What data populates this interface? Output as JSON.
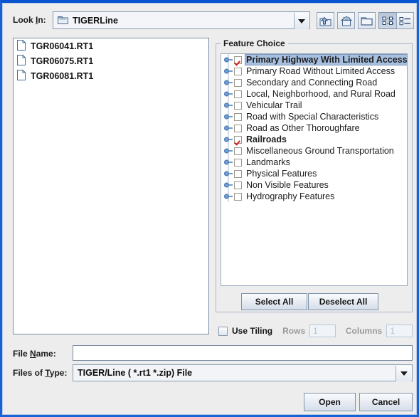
{
  "toolbar": {
    "look_in_label": "Look In:",
    "look_in_label_pre": "Look ",
    "look_in_label_underlined": "I",
    "look_in_label_post": "n:",
    "look_in_value": "TIGERLine",
    "look_in_icon": "folder-icon",
    "dropdown_icon": "chevron-down-icon",
    "buttons": [
      {
        "name": "up-one-level-button",
        "icon": "folder-up-icon",
        "pressed": false
      },
      {
        "name": "home-button",
        "icon": "home-icon",
        "pressed": false
      },
      {
        "name": "new-folder-button",
        "icon": "new-folder-icon",
        "pressed": false
      },
      {
        "name": "tiles-view-button",
        "icon": "grid-view-icon",
        "pressed": true
      },
      {
        "name": "details-view-button",
        "icon": "list-view-icon",
        "pressed": false
      }
    ]
  },
  "file_list": {
    "items": [
      {
        "label": "TGR06041.RT1",
        "icon": "file-icon"
      },
      {
        "label": "TGR06075.RT1",
        "icon": "file-icon"
      },
      {
        "label": "TGR06081.RT1",
        "icon": "file-icon"
      }
    ]
  },
  "feature_choice": {
    "legend": "Feature Choice",
    "tree_items": [
      {
        "label": "Primary Highway With Limited Access",
        "checked": true,
        "selected": true
      },
      {
        "label": "Primary Road Without Limited Access",
        "checked": false,
        "selected": false
      },
      {
        "label": "Secondary and Connecting Road",
        "checked": false,
        "selected": false
      },
      {
        "label": "Local, Neighborhood, and Rural Road",
        "checked": false,
        "selected": false
      },
      {
        "label": "Vehicular Trail",
        "checked": false,
        "selected": false
      },
      {
        "label": "Road with Special Characteristics",
        "checked": false,
        "selected": false
      },
      {
        "label": "Road as Other Thoroughfare",
        "checked": false,
        "selected": false
      },
      {
        "label": "Railroads",
        "checked": true,
        "selected": false
      },
      {
        "label": "Miscellaneous Ground Transportation",
        "checked": false,
        "selected": false
      },
      {
        "label": "Landmarks",
        "checked": false,
        "selected": false
      },
      {
        "label": "Physical Features",
        "checked": false,
        "selected": false
      },
      {
        "label": "Non Visible Features",
        "checked": false,
        "selected": false
      },
      {
        "label": "Hydrography Features",
        "checked": false,
        "selected": false
      }
    ],
    "select_all_label": "Select All",
    "deselect_all_label": "Deselect All"
  },
  "tiling": {
    "checkbox_label": "Use Tiling",
    "checked": false,
    "rows_label": "Rows",
    "rows_value": "1",
    "columns_label": "Columns",
    "columns_value": "1",
    "enabled": false
  },
  "file_name": {
    "label_pre": "File ",
    "label_underlined": "N",
    "label_post": "ame:",
    "value": "",
    "placeholder": ""
  },
  "files_of_type": {
    "label_pre": "Files of ",
    "label_underlined": "T",
    "label_post": "ype:",
    "value": "TIGER/Line ( *.rt1 *.zip) File",
    "dropdown_icon": "chevron-down-icon"
  },
  "dialog_buttons": {
    "open_label": "Open",
    "cancel_label": "Cancel"
  },
  "colors": {
    "window_border": "#1763d6",
    "background": "#ededed",
    "selection": "#a8c0e0",
    "check_mark": "#d41d1d",
    "text": "#1a1a1a",
    "disabled_text": "#9a9a9a"
  }
}
